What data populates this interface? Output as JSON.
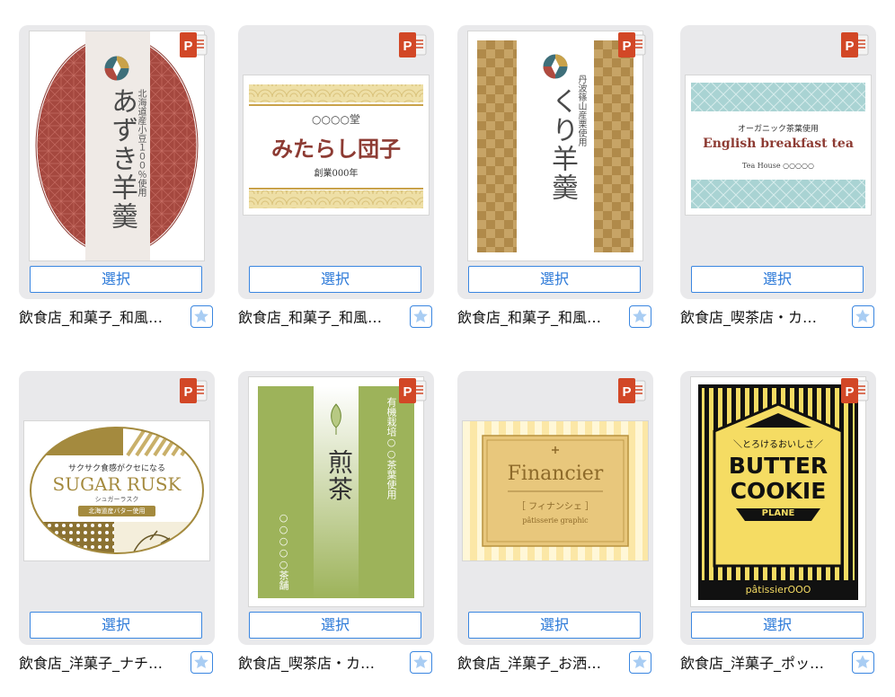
{
  "select_label": "選択",
  "accent_color": "#3a86e0",
  "items": [
    {
      "title": "飲食店_和菓子_和風…",
      "label": {
        "main": "あずき羊羹",
        "sub": "北海道産小豆１００％使用"
      }
    },
    {
      "title": "飲食店_和菓子_和風…",
      "label": {
        "top": "○○○○堂",
        "main": "みたらし団子",
        "sub": "創業000年"
      }
    },
    {
      "title": "飲食店_和菓子_和風…",
      "label": {
        "main": "くり羊羹",
        "sub": "丹波篠山産栗使用"
      }
    },
    {
      "title": "飲食店_喫茶店・カ…",
      "label": {
        "top": "オーガニック茶葉使用",
        "main": "English breakfast tea",
        "sub": "Tea House ○○○○○"
      }
    },
    {
      "title": "飲食店_洋菓子_ナチ…",
      "label": {
        "top": "サクサク食感がクセになる",
        "main": "SUGAR RUSK",
        "sub": "シュガーラスク",
        "note": "北海道産バター使用"
      }
    },
    {
      "title": "飲食店_喫茶店・カ…",
      "label": {
        "main": "煎茶",
        "sub": "有機栽培○○茶葉使用",
        "sub2": "○○○○○茶舗"
      }
    },
    {
      "title": "飲食店_洋菓子_お洒…",
      "label": {
        "main": "Financier",
        "sub": "［ フィナンシェ ］",
        "sub2": "pâtisserie graphic"
      }
    },
    {
      "title": "飲食店_洋菓子_ポッ…",
      "label": {
        "top": "＼とろけるおいしさ／",
        "main": "BUTTER",
        "main2": "COOKIE",
        "ribbon": "PLANE",
        "footer": "pâtissierOOO"
      }
    }
  ]
}
